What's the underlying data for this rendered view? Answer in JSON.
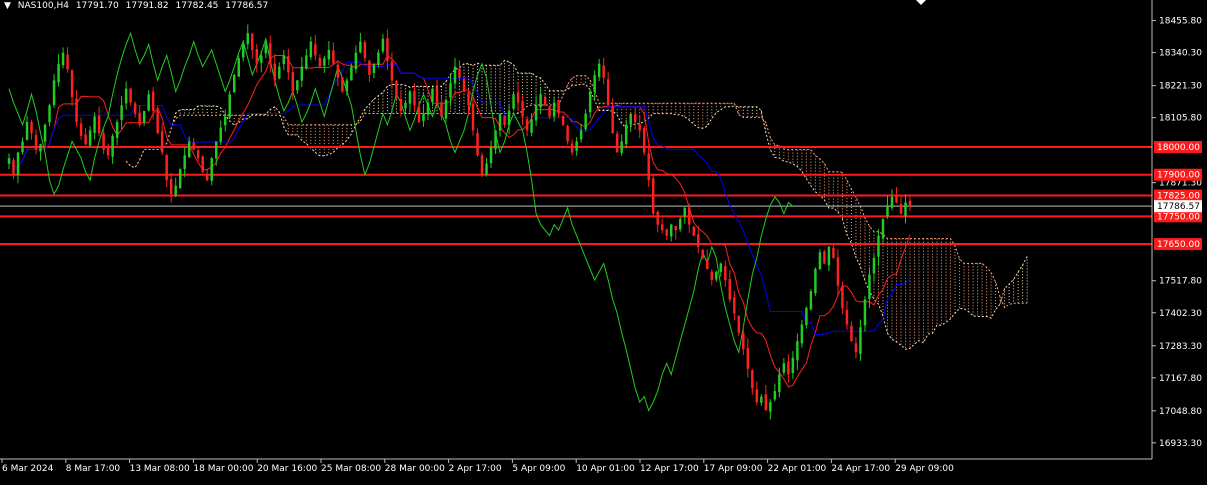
{
  "header": {
    "symbol": "NAS100,H4",
    "open": "17791.70",
    "high": "17791.82",
    "low": "17782.45",
    "close": "17786.57"
  },
  "chart_data": {
    "type": "candlestick",
    "instrument": "NAS100,H4",
    "ylim": [
      16875,
      18530
    ],
    "price_ticks": [
      18455.8,
      18340.3,
      18221.3,
      18105.8,
      17871.3,
      17517.8,
      17402.3,
      17283.3,
      17167.8,
      17048.8,
      16933.3
    ],
    "time_ticks": [
      "6 Mar 2024",
      "8 Mar 17:00",
      "13 Mar 08:00",
      "18 Mar 00:00",
      "20 Mar 16:00",
      "25 Mar 08:00",
      "28 Mar 00:00",
      "2 Apr 17:00",
      "5 Apr 09:00",
      "10 Apr 01:00",
      "12 Apr 17:00",
      "17 Apr 09:00",
      "22 Apr 01:00",
      "24 Apr 17:00",
      "29 Apr 09:00"
    ],
    "current_price": {
      "value": 17786.57,
      "label": "17786.57"
    },
    "horizontal_levels": [
      {
        "value": 18000.0,
        "label": "18000.00"
      },
      {
        "value": 17900.0,
        "label": "17900.00"
      },
      {
        "value": 17825.0,
        "label": "17825.00"
      },
      {
        "value": 17750.0,
        "label": "17750.00"
      },
      {
        "value": 17650.0,
        "label": "17650.00"
      }
    ],
    "candles_close": [
      17960,
      17900,
      17980,
      18020,
      18090,
      18050,
      17990,
      18010,
      18080,
      18150,
      18240,
      18300,
      18340,
      18280,
      18180,
      18090,
      18040,
      18010,
      18060,
      18110,
      18050,
      17990,
      17970,
      18040,
      18090,
      18150,
      18210,
      18160,
      18120,
      18080,
      18130,
      18190,
      18130,
      18050,
      17980,
      17880,
      17830,
      17860,
      17920,
      17970,
      18020,
      17990,
      17960,
      17910,
      17880,
      17960,
      18020,
      18070,
      18110,
      18190,
      18260,
      18320,
      18370,
      18410,
      18350,
      18300,
      18330,
      18370,
      18300,
      18240,
      18290,
      18330,
      18270,
      18200,
      18240,
      18290,
      18330,
      18380,
      18330,
      18290,
      18320,
      18350,
      18300,
      18250,
      18200,
      18240,
      18290,
      18340,
      18380,
      18320,
      18260,
      18300,
      18340,
      18390,
      18310,
      18240,
      18180,
      18130,
      18160,
      18200,
      18150,
      18090,
      18120,
      18160,
      18210,
      18160,
      18110,
      18170,
      18230,
      18290,
      18250,
      18200,
      18150,
      18060,
      17970,
      17900,
      17940,
      18000,
      18060,
      18120,
      18080,
      18130,
      18190,
      18160,
      18110,
      18060,
      18100,
      18150,
      18190,
      18150,
      18110,
      18160,
      18120,
      18080,
      18020,
      17980,
      18020,
      18060,
      18120,
      18200,
      18260,
      18300,
      18250,
      18150,
      18050,
      17980,
      18020,
      18080,
      18120,
      18090,
      18060,
      17980,
      17880,
      17760,
      17720,
      17700,
      17680,
      17720,
      17700,
      17740,
      17780,
      17720,
      17680,
      17640,
      17600,
      17560,
      17520,
      17550,
      17580,
      17520,
      17450,
      17400,
      17330,
      17270,
      17200,
      17130,
      17080,
      17100,
      17050,
      17080,
      17120,
      17180,
      17220,
      17180,
      17240,
      17300,
      17360,
      17420,
      17480,
      17560,
      17620,
      17580,
      17640,
      17600,
      17500,
      17420,
      17360,
      17300,
      17260,
      17350,
      17450,
      17540,
      17600,
      17680,
      17740,
      17790,
      17820,
      17800,
      17760,
      17800,
      17786.57
    ],
    "candles_color": {
      "up": "#22cc22",
      "down": "#ff2020"
    },
    "indicators": {
      "tenkan_color": "#ff2020",
      "kijun_color": "#0000ff",
      "chikou_color": "#22cc22",
      "cloud_bull_color": "#f5deb3",
      "cloud_bear_color": "#ffa07a",
      "cloud_style": "dotted"
    }
  }
}
